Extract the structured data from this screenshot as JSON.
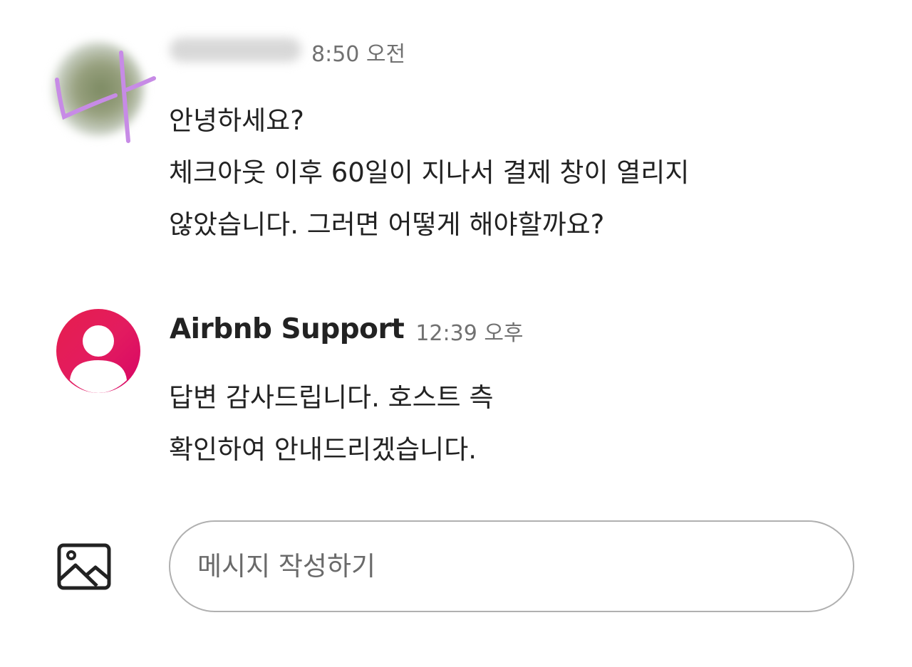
{
  "messages": [
    {
      "sender_name": "",
      "timestamp": "8:50 오전",
      "avatar_mark": "나",
      "body_lines": [
        "안녕하세요?",
        "체크아웃 이후 60일이 지나서 결제 창이 열리지",
        "않았습니다. 그러면 어떻게 해야할까요?"
      ]
    },
    {
      "sender_name": "Airbnb Support",
      "timestamp": "12:39 오후",
      "body_lines": [
        "답변 감사드립니다. 호스트 측",
        "확인하여 안내드리겠습니다."
      ]
    }
  ],
  "composer": {
    "image_icon": "image-icon",
    "placeholder": "메시지 작성하기",
    "value": ""
  },
  "colors": {
    "brand": "#E61E4D",
    "text": "#222222",
    "muted": "#717171",
    "border": "#B0B0B0"
  }
}
